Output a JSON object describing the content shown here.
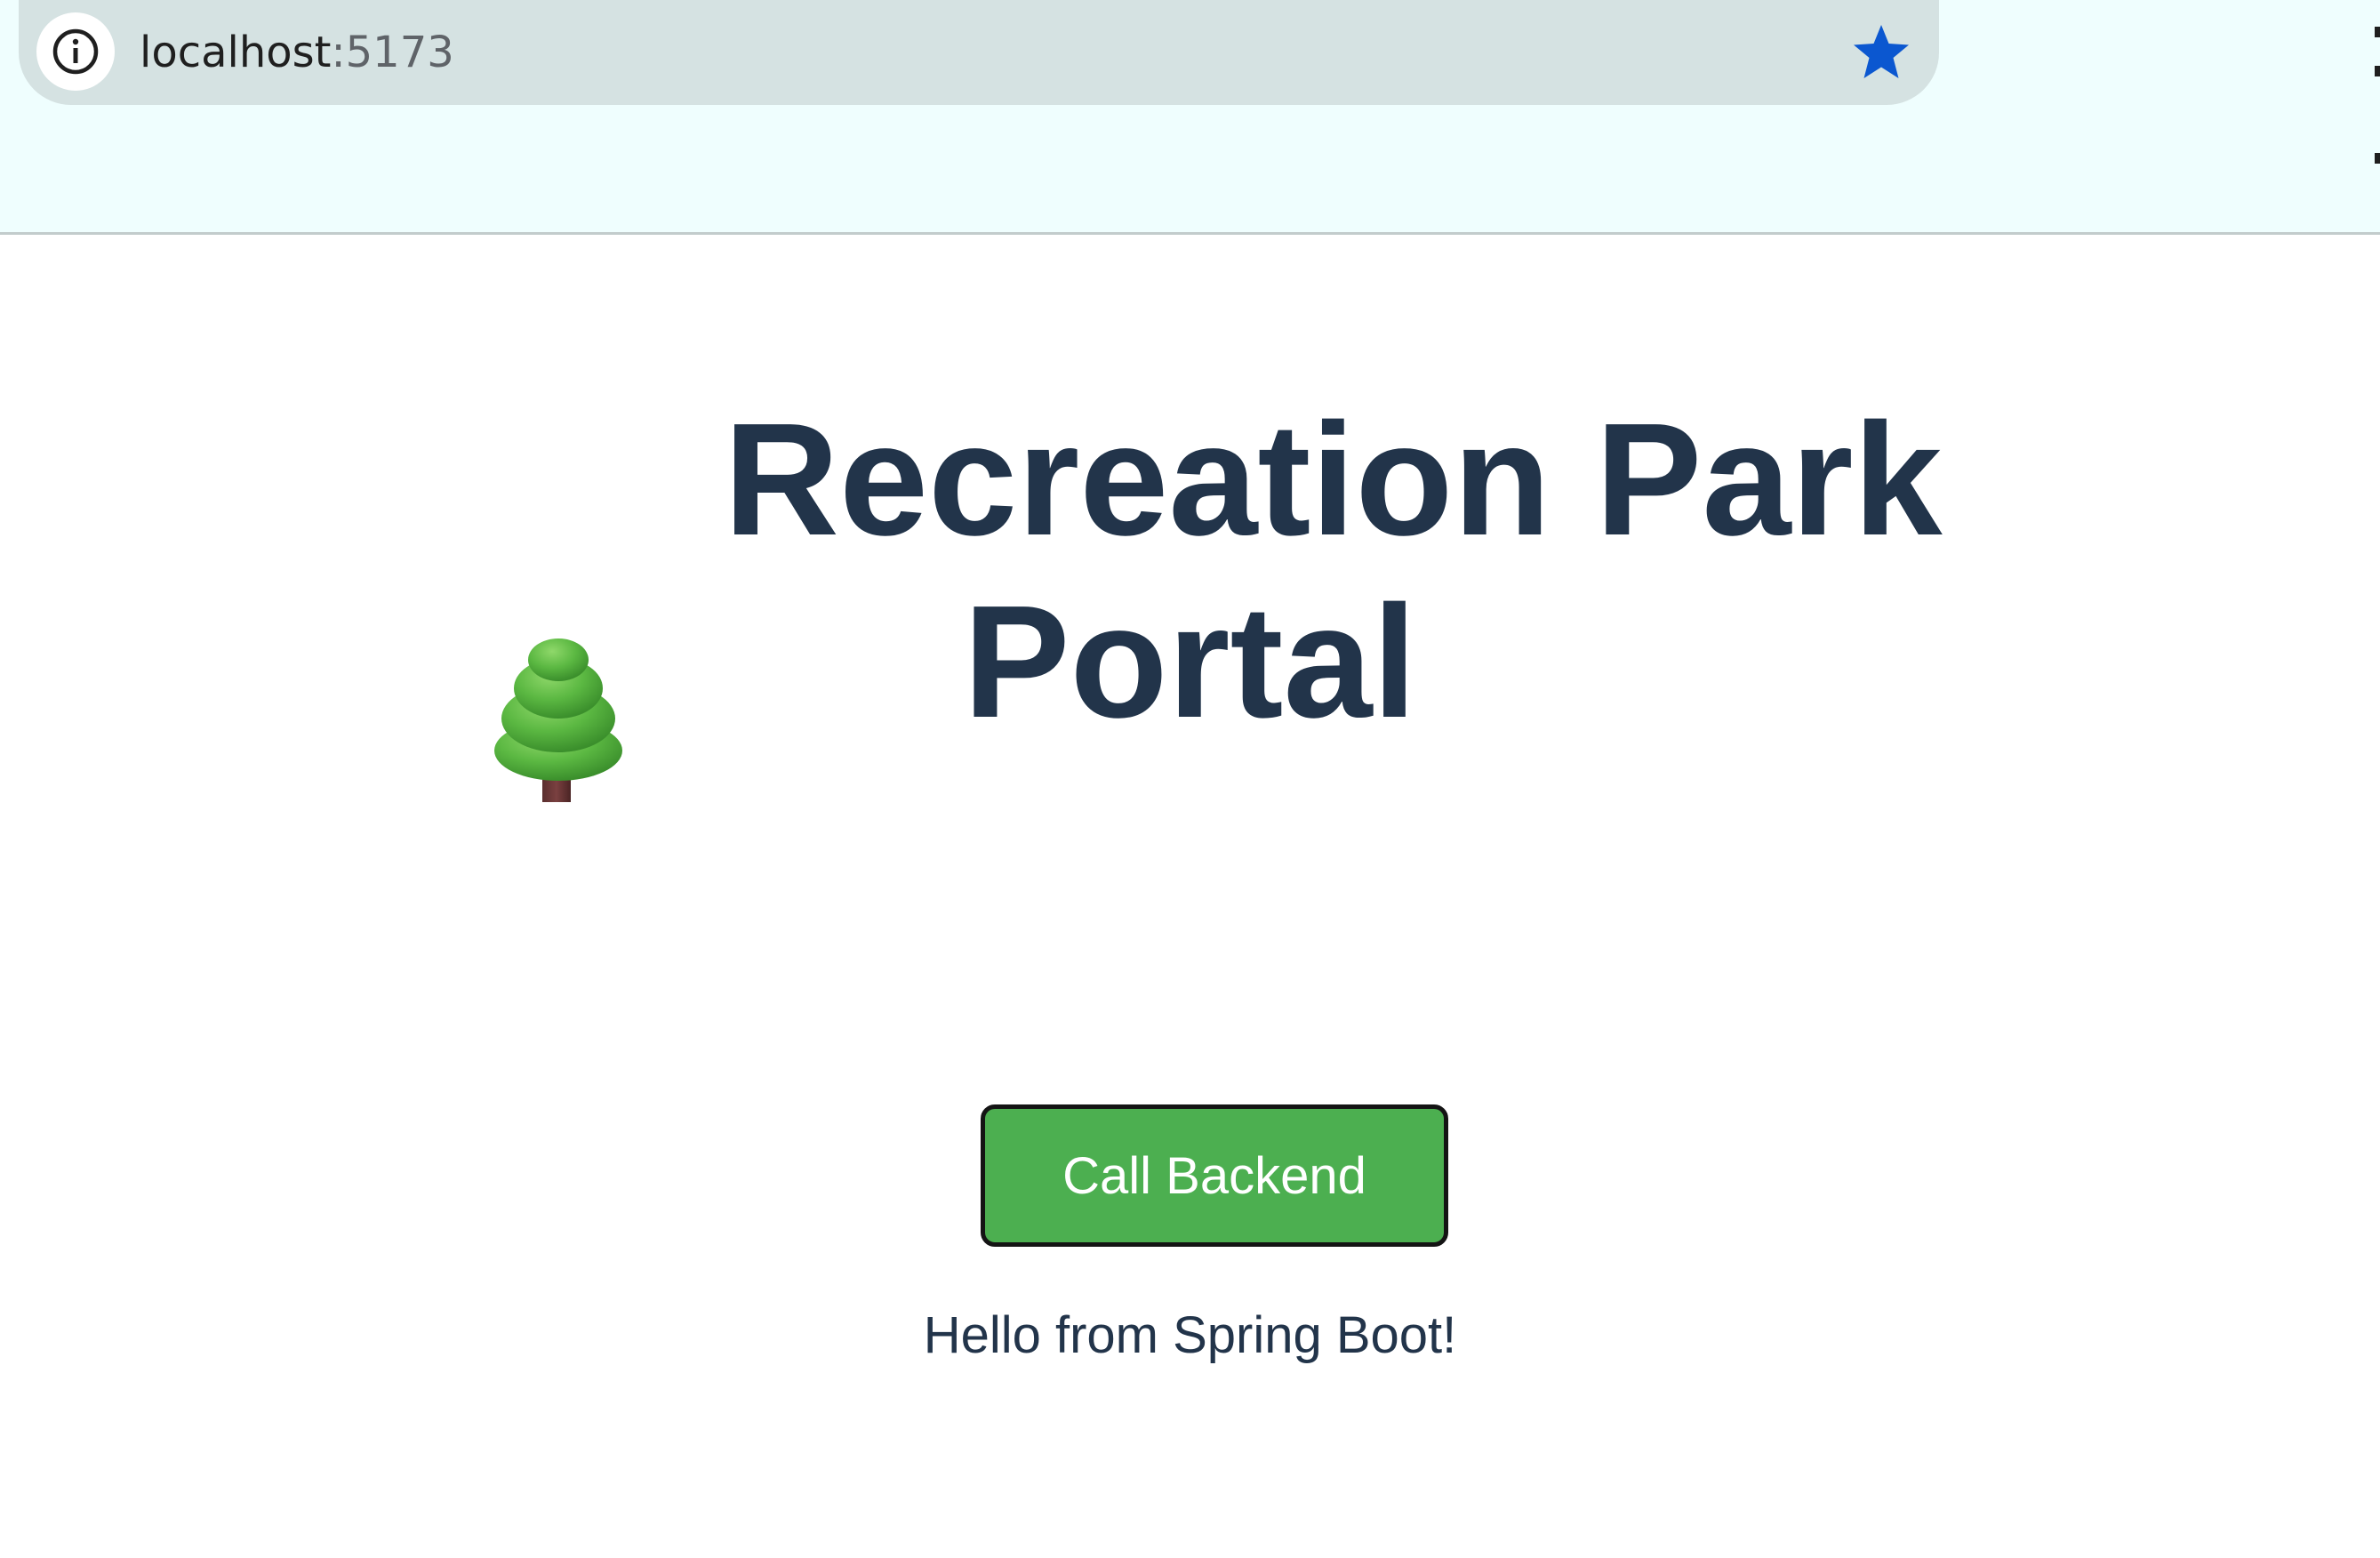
{
  "browser": {
    "url_host": "localhost",
    "url_port": ":5173",
    "site_info_icon": "info-icon",
    "bookmark_icon": "star-icon",
    "bookmark_color": "#0b57d0"
  },
  "page": {
    "title_icon": "deciduous-tree-icon",
    "title_line1": "Recreation Park",
    "title_line2": "Portal",
    "call_button_label": "Call Backend",
    "response_message": "Hello from Spring Boot!",
    "title_color": "#22344a",
    "button_color": "#4caf50"
  }
}
